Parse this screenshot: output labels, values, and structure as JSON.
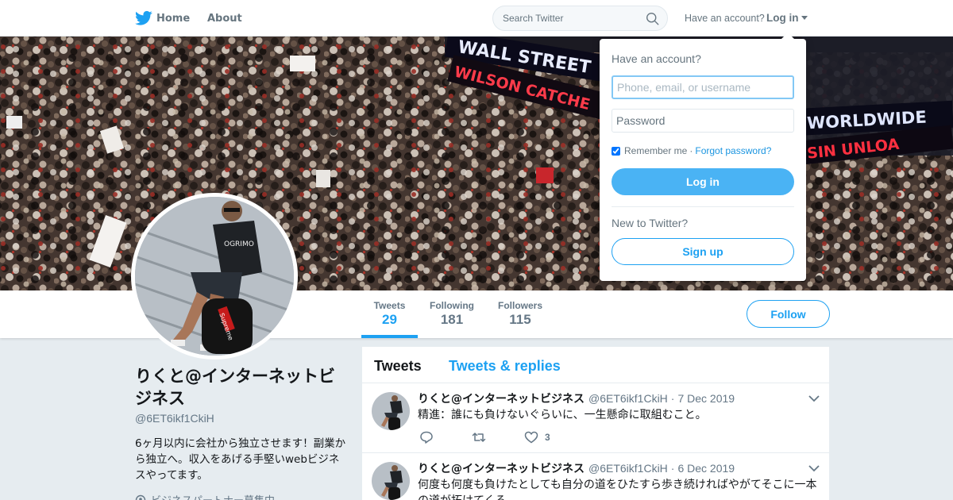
{
  "nav": {
    "home_label": "Home",
    "about_label": "About",
    "search_placeholder": "Search Twitter",
    "have_account": "Have an account?",
    "login_label": "Log in"
  },
  "banner": {
    "signs": [
      "WALL STREET",
      "WILSON CATCHE",
      "WORLDWIDE",
      "SIN UNLOA"
    ]
  },
  "profile": {
    "name": "りくと@インターネットビジネス",
    "handle": "@6ET6ikf1CkiH",
    "bio": "6ヶ月以内に会社から独立させます！副業から独立へ。収入をあげる手堅いwebビジネスやってます。",
    "location_partial": "ビジネスパートナー募集中"
  },
  "stats": [
    {
      "label": "Tweets",
      "value": "29"
    },
    {
      "label": "Following",
      "value": "181"
    },
    {
      "label": "Followers",
      "value": "115"
    }
  ],
  "follow_label": "Follow",
  "timeline": {
    "tabs": [
      "Tweets",
      "Tweets & replies"
    ],
    "tweets": [
      {
        "name": "りくと@インターネットビジネス",
        "handle": "@6ET6ikf1CkiH",
        "date": "7 Dec 2019",
        "text": "精進：誰にも負けないぐらいに、一生懸命に取組むこと。",
        "likes": "3"
      },
      {
        "name": "りくと@インターネットビジネス",
        "handle": "@6ET6ikf1CkiH",
        "date": "6 Dec 2019",
        "text": "何度も何度も負けたとしても自分の道をひたすら歩き続ければやがてそこに一本の道が拓けてくる",
        "likes": ""
      }
    ]
  },
  "login_dropdown": {
    "title": "Have an account?",
    "username_placeholder": "Phone, email, or username",
    "password_placeholder": "Password",
    "remember_label": "Remember me",
    "separator": "·",
    "forgot_label": "Forgot password?",
    "login_button": "Log in",
    "new_label": "New to Twitter?",
    "signup_button": "Sign up"
  },
  "colors": {
    "accent": "#1da1f2",
    "login_button": "#4ab3f4",
    "page_bg": "#e6ecf0",
    "muted": "#657786"
  },
  "icons": [
    "twitter-bird-icon",
    "search-icon",
    "caret-down-icon",
    "chevron-down-icon",
    "reply-icon",
    "retweet-icon",
    "like-icon",
    "location-pin-icon"
  ]
}
